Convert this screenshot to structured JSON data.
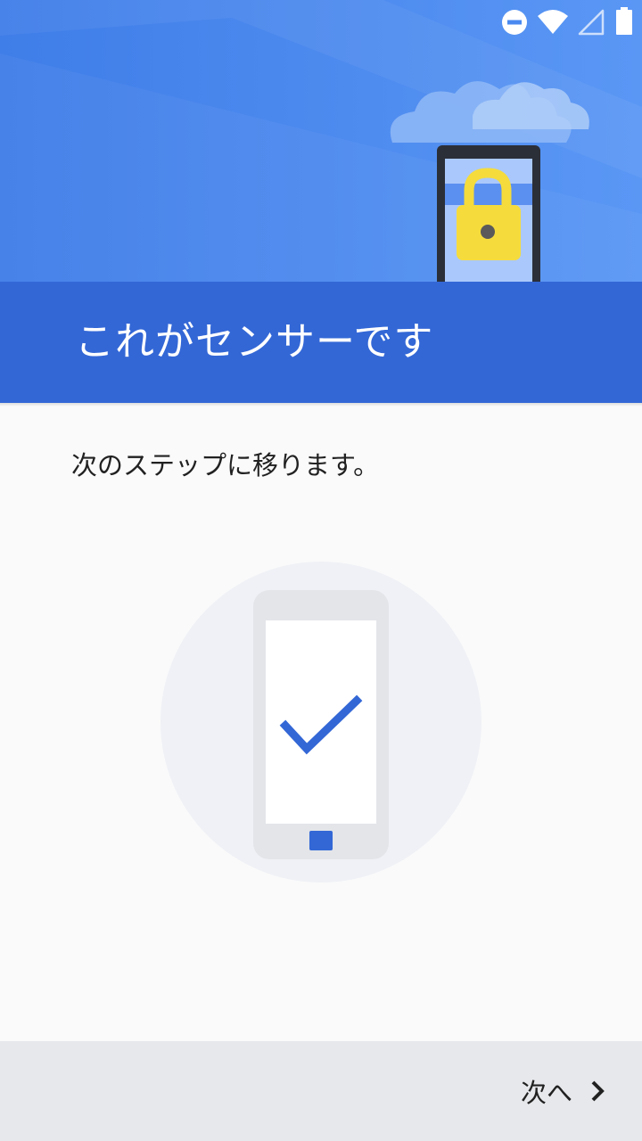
{
  "status_bar": {
    "icons": [
      "do-not-disturb-icon",
      "wifi-icon",
      "cellular-signal-icon",
      "battery-icon"
    ]
  },
  "header": {
    "title": "これがセンサーです",
    "illustration": "phone-lock-icon"
  },
  "main": {
    "description": "次のステップに移ります。",
    "illustration": "phone-check-icon"
  },
  "footer": {
    "next_label": "次へ",
    "next_icon": "chevron-right-icon"
  },
  "colors": {
    "header_light": "#4a8af0",
    "header_band": "#3367d6",
    "accent": "#3367d6",
    "lock": "#f5dc3c",
    "footer_bg": "#e6e8eb",
    "page_bg": "#fafafa"
  }
}
